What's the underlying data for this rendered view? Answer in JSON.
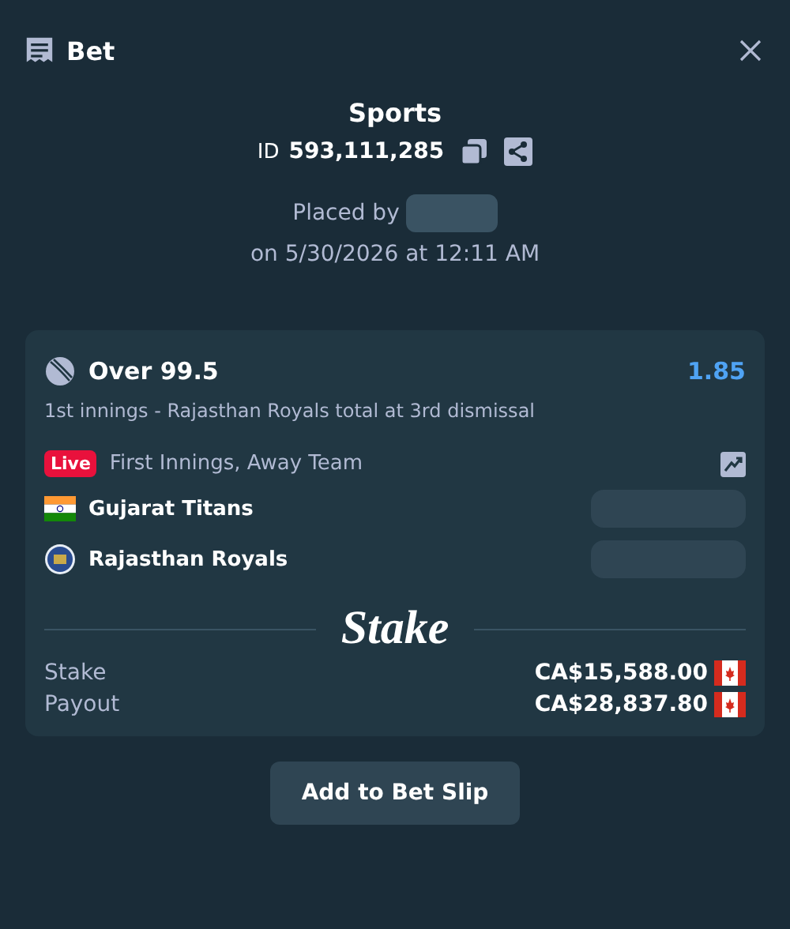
{
  "header": {
    "title": "Bet"
  },
  "summary": {
    "title": "Sports",
    "id_label": "ID",
    "id_value": "593,111,285",
    "placed_by": "Placed by",
    "placed_on": "on 5/30/2026 at 12:11 AM"
  },
  "selection": {
    "name": "Over 99.5",
    "odds": "1.85",
    "market": "1st innings - Rajasthan Royals total at 3rd dismissal",
    "live_badge": "Live",
    "period": "First Innings, Away Team",
    "teams": [
      {
        "name": "Gujarat Titans",
        "kind": "flag"
      },
      {
        "name": "Rajasthan Royals",
        "kind": "crest"
      }
    ]
  },
  "logo": "Stake",
  "totals": [
    {
      "label": "Stake",
      "amount": "CA$15,588.00"
    },
    {
      "label": "Payout",
      "amount": "CA$28,837.80"
    }
  ],
  "button": "Add to Bet Slip"
}
